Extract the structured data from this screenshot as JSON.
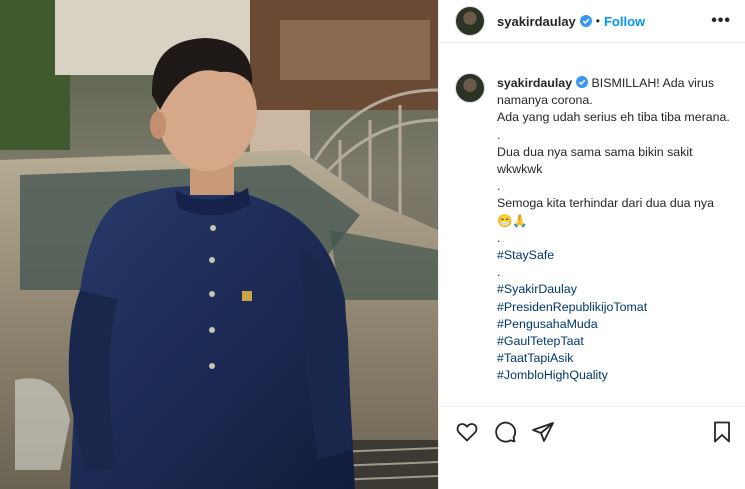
{
  "header": {
    "username": "syakirdaulay",
    "separator": "•",
    "follow_label": "Follow",
    "more_label": "•••"
  },
  "caption": {
    "username": "syakirdaulay",
    "lines": [
      "BISMILLAH! Ada virus namanya corona.",
      "Ada yang udah serius eh tiba tiba merana.",
      ".",
      "Dua dua nya sama sama bikin sakit wkwkwk",
      ".",
      "Semoga kita terhindar dari dua dua nya 😁🙏",
      ".",
      "#StaySafe",
      ".",
      "#SyakirDaulay",
      "#PresidenRepublikijoTomat",
      "#PengusahaMuda",
      "#GaulTetepTaat",
      "#TaatTapiAsik",
      "#JombloHighQuality"
    ]
  },
  "icons": {
    "verified": "verified-badge-icon",
    "like": "heart-icon",
    "comment": "comment-icon",
    "share": "paper-plane-icon",
    "save": "bookmark-icon"
  },
  "colors": {
    "accent": "#0095f6",
    "verified": "#3897f0",
    "hashtag": "#00376b",
    "text": "#262626"
  }
}
